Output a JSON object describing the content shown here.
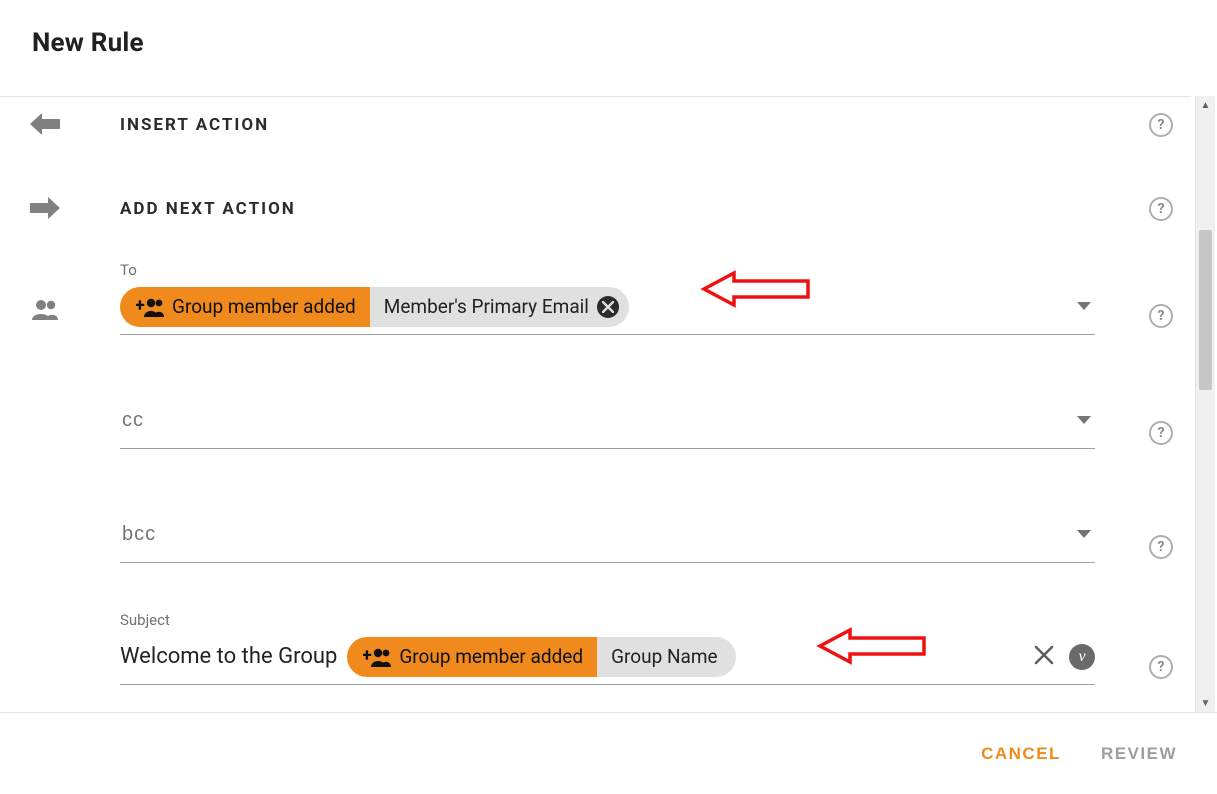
{
  "title": "New Rule",
  "insert_action": {
    "heading": "INSERT ACTION"
  },
  "add_next_action": {
    "heading": "ADD NEXT ACTION"
  },
  "fields": {
    "to": {
      "label": "To",
      "chip_event": "Group member added",
      "chip_field": "Member's Primary Email"
    },
    "cc": {
      "placeholder": "cc"
    },
    "bcc": {
      "placeholder": "bcc"
    },
    "subject": {
      "label": "Subject",
      "text": "Welcome to the Group",
      "chip_event": "Group member added",
      "chip_field": "Group Name"
    }
  },
  "footer": {
    "cancel": "CANCEL",
    "review": "REVIEW"
  },
  "icons": {
    "var_button": "v"
  }
}
